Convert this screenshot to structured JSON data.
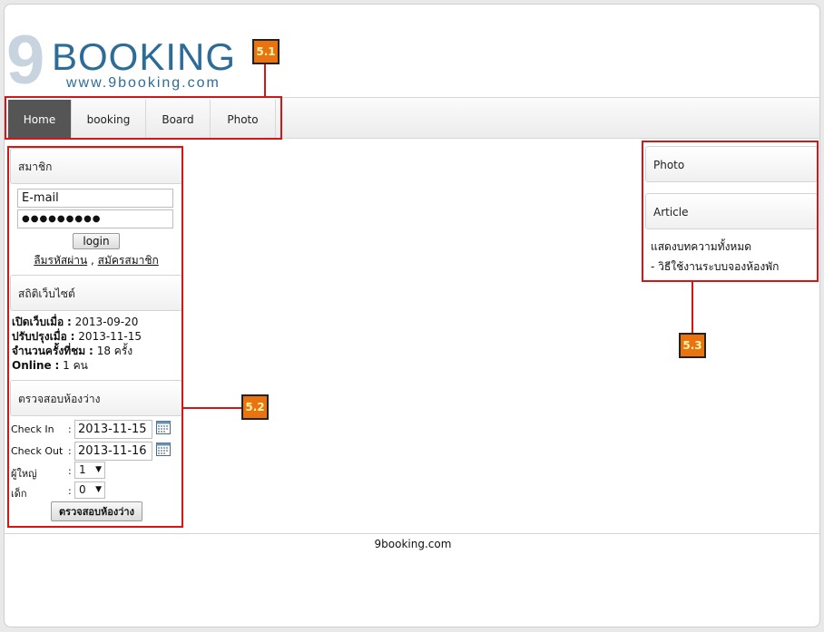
{
  "logo": {
    "nine": "9",
    "word": "BOOKING",
    "url": "www.9booking.com"
  },
  "nav": [
    {
      "label": "Home",
      "active": true
    },
    {
      "label": "booking",
      "active": false
    },
    {
      "label": "Board",
      "active": false
    },
    {
      "label": "Photo",
      "active": false
    }
  ],
  "member": {
    "title": "สมาชิก",
    "email_value": "E-mail",
    "password_mask": "●●●●●●●●●",
    "login_label": "login",
    "forgot_label": "ลืมรหัสผ่าน",
    "separator": ",",
    "register_label": "สมัครสมาชิก"
  },
  "stats": {
    "title": "สถิติเว็บไซต์",
    "opened_label": "เปิดเว็บเมื่อ",
    "opened_value": "2013-09-20",
    "updated_label": "ปรับปรุงเมื่อ",
    "updated_value": "2013-11-15",
    "visits_label": "จำนวนครั้งที่ชม",
    "visits_value": "18 ครั้ง",
    "online_label": "Online",
    "online_value": "1 คน",
    "colon": ":"
  },
  "availability": {
    "title": "ตรวจสอบห้องว่าง",
    "checkin_label": "Check In",
    "checkin_value": "2013-11-15",
    "checkout_label": "Check Out",
    "checkout_value": "2013-11-16",
    "adults_label": "ผู้ใหญ่",
    "adults_value": "1",
    "children_label": "เด็ก",
    "children_value": "0",
    "colon": ":",
    "submit_label": "ตรวจสอบห้องว่าง"
  },
  "right": {
    "photo_title": "Photo",
    "article_title": "Article",
    "show_all": "แสดงบทความทั้งหมด",
    "article_1": "- วิธีใช้งานระบบจองห้องพัก"
  },
  "footer": {
    "text": "9booking.com"
  },
  "annotations": {
    "tag_1": "5.1",
    "tag_2": "5.2",
    "tag_3": "5.3"
  },
  "colors": {
    "annotation_red": "#d01818",
    "tag_orange": "#e8730f",
    "nav_active": "#555555",
    "brand_blue": "#2e6c98"
  }
}
